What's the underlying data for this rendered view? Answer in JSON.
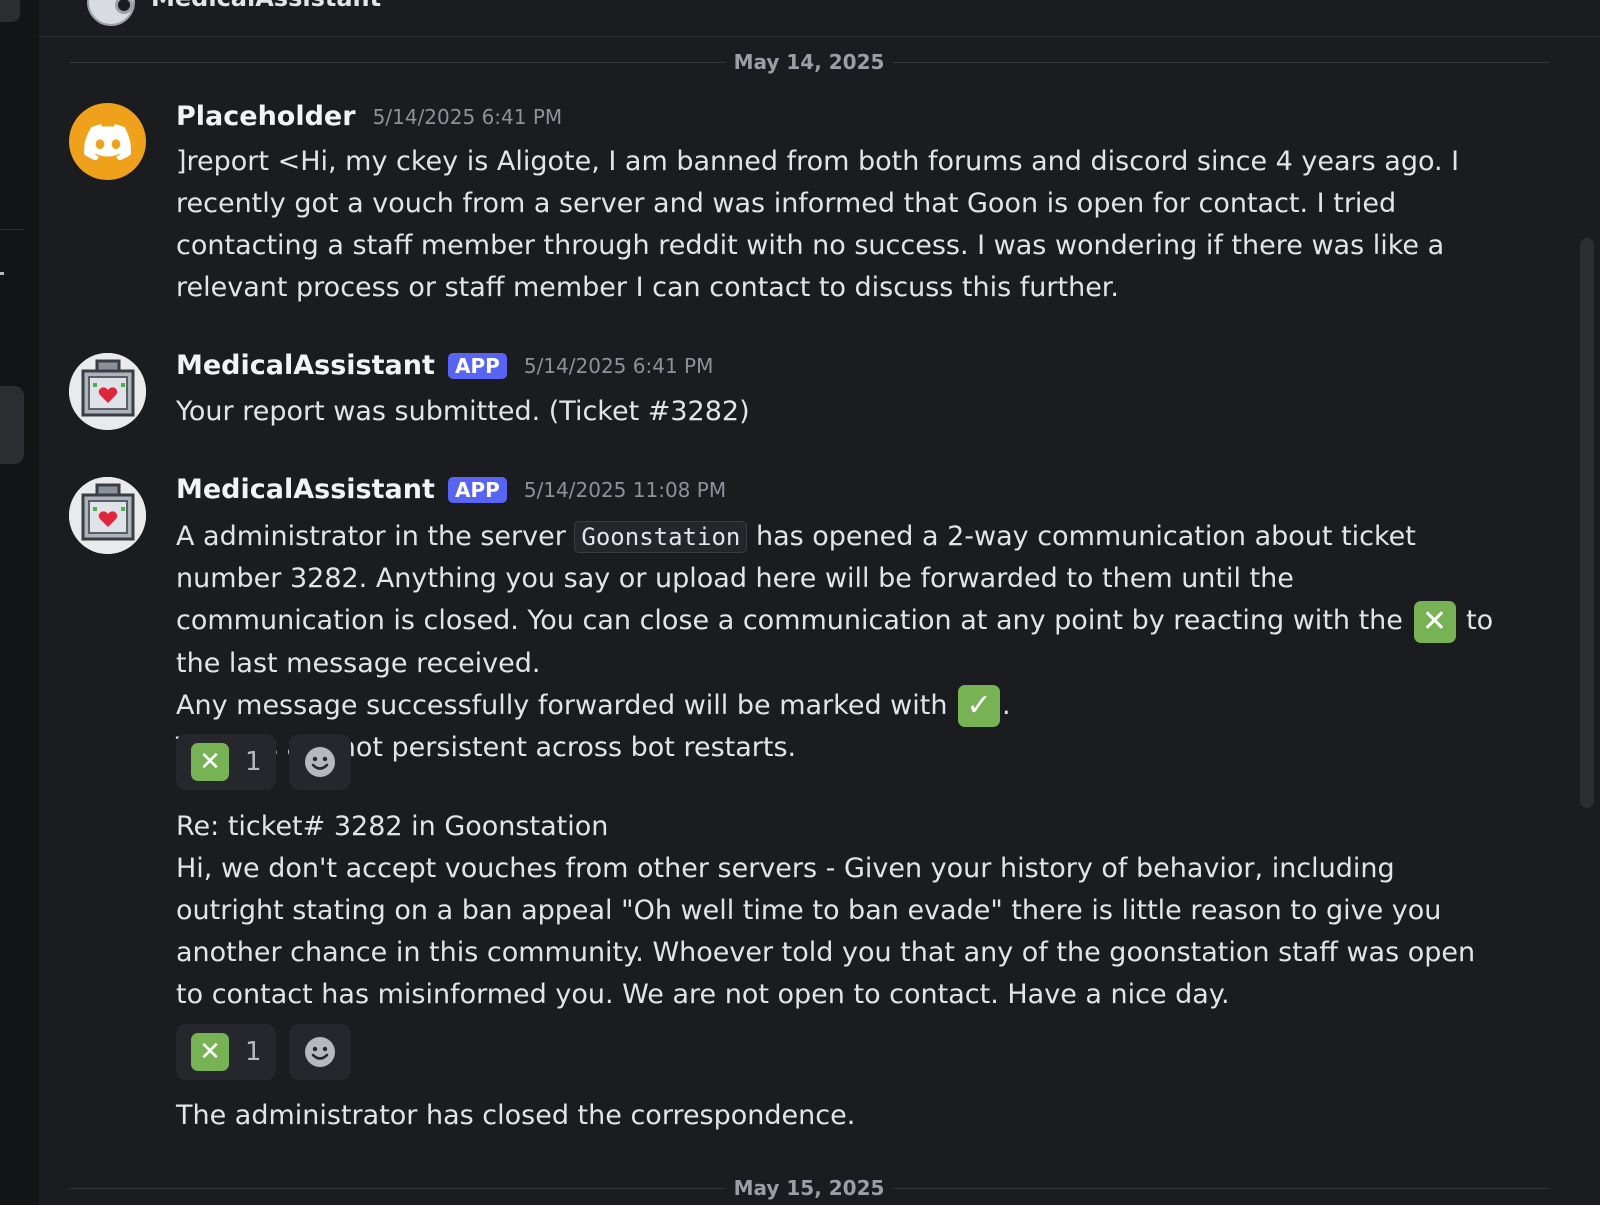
{
  "header": {
    "channel_name": "MedicalAssistant"
  },
  "date_separators": {
    "first": "May 14, 2025",
    "second": "May 15, 2025"
  },
  "messages": [
    {
      "username": "Placeholder",
      "timestamp": "5/14/2025 6:41 PM",
      "text": "]report <Hi, my ckey is Aligote, I am banned from both forums and discord since 4 years ago. I recently got a vouch from a server and was informed that Goon is open for contact. I tried contacting a staff member through reddit with no success. I was wondering if there was like a relevant process or staff member I can contact to discuss this further."
    },
    {
      "username": "MedicalAssistant",
      "badge": "APP",
      "timestamp": "5/14/2025 6:41 PM",
      "text": "Your report was submitted. (Ticket #3282)"
    },
    {
      "username": "MedicalAssistant",
      "badge": "APP",
      "timestamp": "5/14/2025 11:08 PM",
      "text_part1": "A administrator in the server",
      "code": "Goonstation",
      "text_part2": "has opened a 2-way communication about ticket number 3282. Anything you say or upload here will be forwarded to them until the communication is closed. You can close a communication at any point by reacting with the",
      "text_part3": "to the last message received.",
      "text_part4": "Any message successfully forwarded will be marked with",
      "text_part5": ".",
      "text_part6": "Tunnels are not persistent across bot restarts.",
      "reaction": {
        "emoji": "cross-mark-button",
        "count": "1"
      }
    },
    {
      "title": "Re: ticket# 3282 in Goonstation",
      "text": "Hi, we don't accept vouches from other servers - Given your history of behavior, including outright stating on a ban appeal \"Oh well time to ban evade\" there is little reason to give you another chance in this community. Whoever told you that any of the goonstation staff was open to contact has misinformed you. We are not open to contact. Have a nice day.",
      "reaction": {
        "emoji": "cross-mark-button",
        "count": "1"
      }
    },
    {
      "text": "The administrator has closed the correspondence."
    }
  ],
  "emoji": {
    "cross": "✕",
    "check": "✓"
  },
  "colors": {
    "accent": "#5865f2",
    "emoji_green": "#77b255",
    "discord_avatar": "#f0a11b"
  }
}
